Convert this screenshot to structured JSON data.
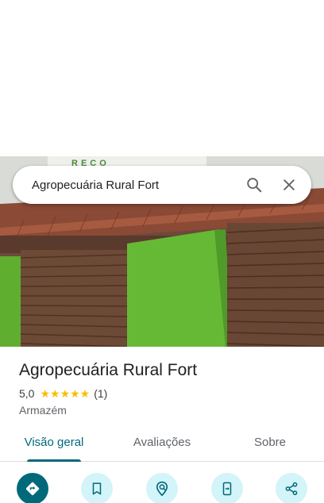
{
  "search": {
    "query": "Agropecuária Rural Fort",
    "search_icon": "search-icon",
    "close_icon": "close-icon"
  },
  "photo": {
    "signage_text": "RECO"
  },
  "place": {
    "name": "Agropecuária Rural Fort",
    "rating": "5,0",
    "stars": "★★★★★",
    "review_count": "(1)",
    "category": "Armazém"
  },
  "tabs": [
    {
      "label": "Visão geral",
      "active": true
    },
    {
      "label": "Avaliações",
      "active": false
    },
    {
      "label": "Sobre",
      "active": false
    }
  ],
  "actions": [
    {
      "icon": "directions-icon",
      "primary": true
    },
    {
      "icon": "bookmark-icon",
      "primary": false
    },
    {
      "icon": "nearby-icon",
      "primary": false
    },
    {
      "icon": "send-to-phone-icon",
      "primary": false
    },
    {
      "icon": "share-icon",
      "primary": false
    }
  ],
  "colors": {
    "accent": "#00697a",
    "action_bg": "#d3f4f9",
    "star": "#fbbc04"
  }
}
